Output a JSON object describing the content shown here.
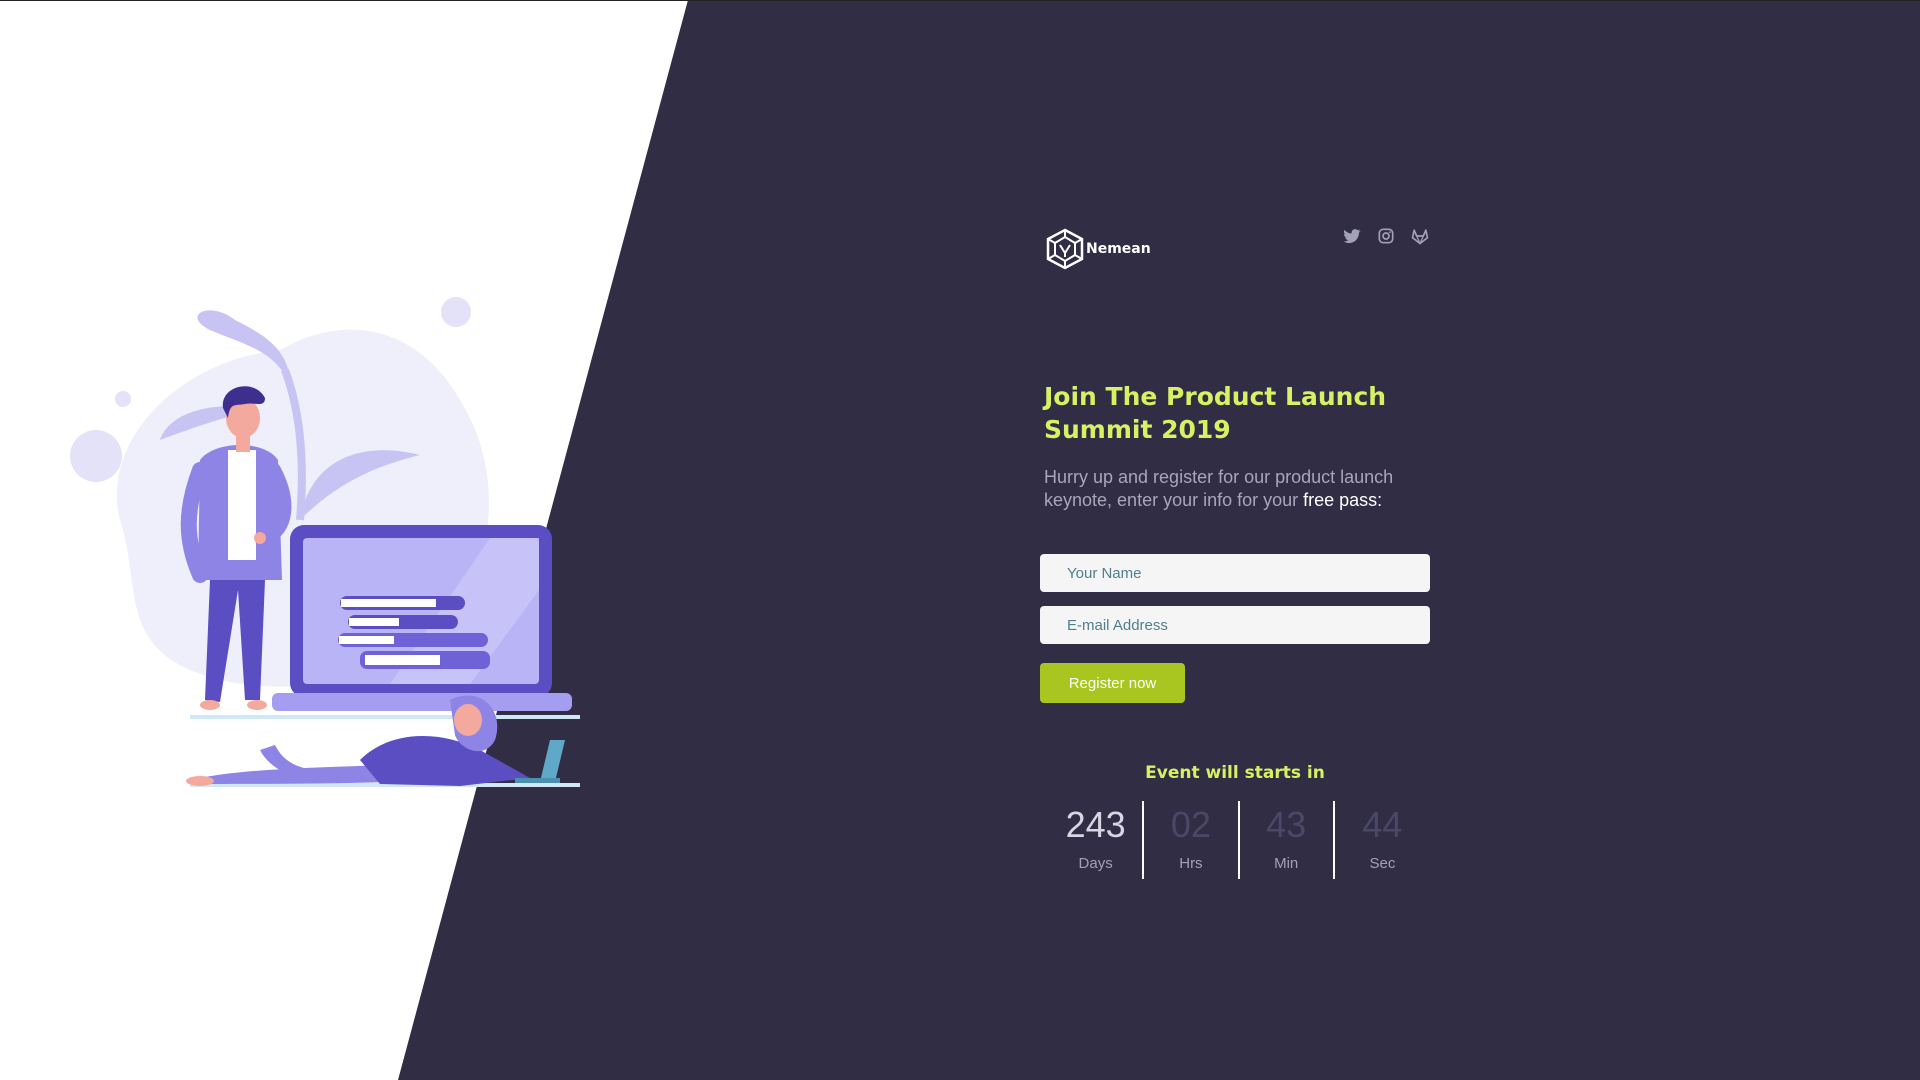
{
  "brand": {
    "name": "Nemean"
  },
  "social": {
    "icons": [
      "twitter-icon",
      "instagram-icon",
      "gitlab-icon"
    ]
  },
  "hero": {
    "title": "Join The Product Launch Summit 2019",
    "subtitle_lead": "Hurry up and register for our product launch keynote, enter your info for your ",
    "subtitle_emphasis": "free pass:"
  },
  "form": {
    "name_placeholder": "Your Name",
    "name_value": "",
    "email_placeholder": "E-mail Address",
    "email_value": "",
    "submit_label": "Register now"
  },
  "countdown": {
    "title": "Event will starts in",
    "days": {
      "value": "243",
      "label": "Days"
    },
    "hours": {
      "value": "02",
      "label": "Hrs"
    },
    "minutes": {
      "value": "43",
      "label": "Min"
    },
    "seconds": {
      "value": "44",
      "label": "Sec"
    }
  },
  "colors": {
    "panel_background": "#302d45",
    "accent_yellow": "#d6f264",
    "button_green": "#a9c520",
    "illustration_purple": "#5b4ec2"
  }
}
